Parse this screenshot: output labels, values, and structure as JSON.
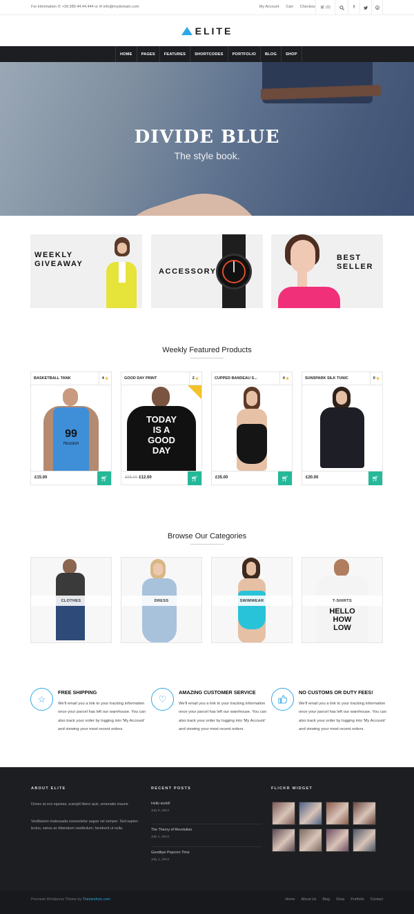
{
  "topbar": {
    "info_label": "For information",
    "phone": "+39.389.44.44.444",
    "or": "or",
    "email": "info@mydomain.com",
    "links": [
      "My Account",
      "Cart",
      "Checkout"
    ],
    "cart_count": "(0)",
    "social_icons": [
      "facebook-icon",
      "twitter-icon",
      "pinterest-icon"
    ]
  },
  "logo": {
    "text": "ELITE",
    "color": "#2da7e7"
  },
  "nav": {
    "items": [
      "HOME",
      "PAGES",
      "FEATURES",
      "SHORTCODES",
      "PORTFOLIO",
      "BLOG",
      "SHOP"
    ]
  },
  "hero": {
    "title": "DIVIDE BLUE",
    "subtitle": "The style book."
  },
  "promos": [
    {
      "line1": "WEEKLY",
      "line2": "GIVEAWAY"
    },
    {
      "line1": "ACCESSORY",
      "line2": ""
    },
    {
      "line1": "BEST",
      "line2": "SELLER"
    }
  ],
  "featured": {
    "title": "Weekly Featured Products",
    "products": [
      {
        "name": "BASKETBALL TANK",
        "rating": "4",
        "old_price": "",
        "price": "£15.00",
        "shirt_text": [
          "99",
          "Houston"
        ]
      },
      {
        "name": "GOOD DAY PRINT",
        "rating": "2",
        "old_price": "£55.00",
        "price": "£12.00",
        "shirt_text": [
          "TODAY",
          "IS A",
          "GOOD",
          "DAY"
        ]
      },
      {
        "name": "CUPPED BANDEAU S...",
        "rating": "4",
        "old_price": "",
        "price": "£35.00",
        "shirt_text": []
      },
      {
        "name": "SUNSPARK SILK TUNIC",
        "rating": "0",
        "old_price": "",
        "price": "£20.00",
        "shirt_text": []
      }
    ]
  },
  "categories": {
    "title": "Browse Our Categories",
    "items": [
      {
        "label": "CLOTHES"
      },
      {
        "label": "DRESS"
      },
      {
        "label": "SWIMWEAR"
      },
      {
        "label": "T-SHIRTS",
        "shirt_text": [
          "HELLO",
          "HOW",
          "LOW"
        ]
      }
    ]
  },
  "features": [
    {
      "icon": "star-icon",
      "title": "FREE SHIPPING",
      "text": "We'll email you a link to your tracking information once your parcel has left our warehouse. You can also track your order by logging into 'My Account' and viewing your most recent orders."
    },
    {
      "icon": "heart-icon",
      "title": "AMAZING CUSTOMER SERVICE",
      "text": "We'll email you a link to your tracking information once your parcel has left our warehouse. You can also track your order by logging into 'My Account' and viewing your most recent orders."
    },
    {
      "icon": "thumbs-up-icon",
      "title": "NO CUSTOMS OR DUTY FEES!",
      "text": "We'll email you a link to your tracking information once your parcel has left our warehouse. You can also track your order by logging into 'My Account' and viewing your most recent orders."
    }
  ],
  "footer": {
    "about_title": "ABOUT ELITE",
    "about_p1": "Donec at orci egestas, suscipit libero quis, venenatis mauris.",
    "about_p2": "Vestibulum malesuada consectetur augue vel semper. Sed sapien lectus, varius ac bibendum vestibulum, hendrerit ut nulla.",
    "posts_title": "RECENT POSTS",
    "posts": [
      {
        "title": "Hello world!",
        "date": "July 5, 2014"
      },
      {
        "title": "The Theory of Revolution",
        "date": "July 1, 2014"
      },
      {
        "title": "Goodbye Popcorn Time",
        "date": "July 1, 2014"
      }
    ],
    "flickr_title": "FLICKR WIDGET",
    "flickr_colors": [
      "#7b5a55",
      "#4e5f86",
      "#8a5a4c",
      "#6a4640",
      "#5b4a52",
      "#7a6a60",
      "#6d4d63",
      "#4c5566"
    ],
    "copyright_prefix": "Premium Wordpress Theme by",
    "copyright_link": "Themeshoic.com",
    "bottom_links": [
      "Home",
      "About Us",
      "Blog",
      "Shop",
      "Portfolio",
      "Contact"
    ]
  },
  "colors": {
    "accent": "#2da7e7",
    "cart_button": "#25b999",
    "dark": "#1d1e22",
    "star": "#f2b82a"
  }
}
